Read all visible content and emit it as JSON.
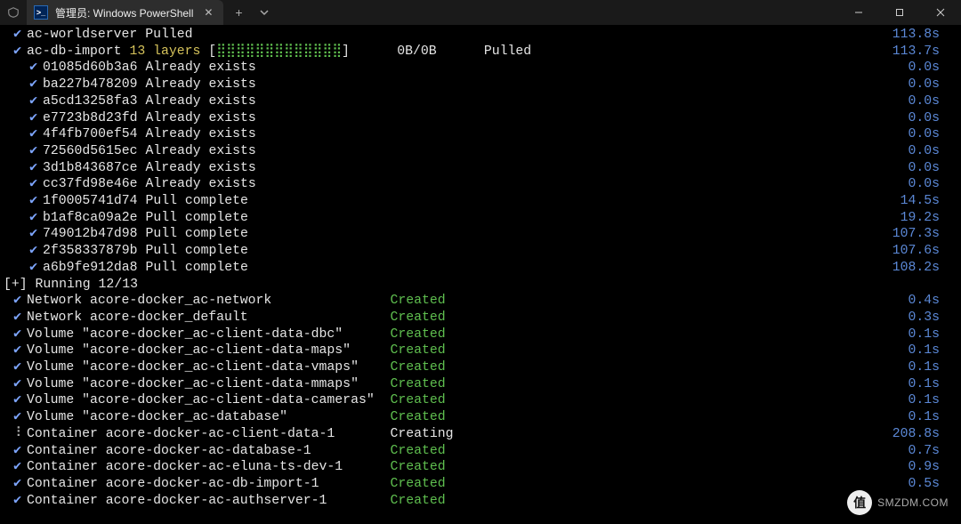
{
  "window": {
    "tab_title": "管理员: Windows PowerShell"
  },
  "pulls": [
    {
      "ind": "top",
      "name": "ac-worldserver",
      "status": "Pulled",
      "status_cls": "white",
      "time": "113.8s"
    },
    {
      "ind": "top",
      "name": "ac-db-import",
      "layers": "13 layers",
      "bar": "[⣿⣿⣿⣿⣿⣿⣿⣿⣿⣿⣿⣿⣿]",
      "bytes": "0B/0B",
      "status": "Pulled",
      "status_cls": "white",
      "time": "113.7s"
    },
    {
      "ind": "sub",
      "name": "01085d60b3a6",
      "status": "Already exists",
      "status_cls": "white",
      "time": "0.0s"
    },
    {
      "ind": "sub",
      "name": "ba227b478209",
      "status": "Already exists",
      "status_cls": "white",
      "time": "0.0s"
    },
    {
      "ind": "sub",
      "name": "a5cd13258fa3",
      "status": "Already exists",
      "status_cls": "white",
      "time": "0.0s"
    },
    {
      "ind": "sub",
      "name": "e7723b8d23fd",
      "status": "Already exists",
      "status_cls": "white",
      "time": "0.0s"
    },
    {
      "ind": "sub",
      "name": "4f4fb700ef54",
      "status": "Already exists",
      "status_cls": "white",
      "time": "0.0s"
    },
    {
      "ind": "sub",
      "name": "72560d5615ec",
      "status": "Already exists",
      "status_cls": "white",
      "time": "0.0s"
    },
    {
      "ind": "sub",
      "name": "3d1b843687ce",
      "status": "Already exists",
      "status_cls": "white",
      "time": "0.0s"
    },
    {
      "ind": "sub",
      "name": "cc37fd98e46e",
      "status": "Already exists",
      "status_cls": "white",
      "time": "0.0s"
    },
    {
      "ind": "sub",
      "name": "1f0005741d74",
      "status": "Pull complete",
      "status_cls": "white",
      "time": "14.5s"
    },
    {
      "ind": "sub",
      "name": "b1af8ca09a2e",
      "status": "Pull complete",
      "status_cls": "white",
      "time": "19.2s"
    },
    {
      "ind": "sub",
      "name": "749012b47d98",
      "status": "Pull complete",
      "status_cls": "white",
      "time": "107.3s"
    },
    {
      "ind": "sub",
      "name": "2f358337879b",
      "status": "Pull complete",
      "status_cls": "white",
      "time": "107.6s"
    },
    {
      "ind": "sub",
      "name": "a6b9fe912da8",
      "status": "Pull complete",
      "status_cls": "white",
      "time": "108.2s"
    }
  ],
  "running_header": "[+] Running 12/13",
  "resources": [
    {
      "spin": false,
      "label": "Network acore-docker_ac-network",
      "status": "Created",
      "status_cls": "green",
      "time": "0.4s"
    },
    {
      "spin": false,
      "label": "Network acore-docker_default",
      "status": "Created",
      "status_cls": "green",
      "time": "0.3s"
    },
    {
      "spin": false,
      "label": "Volume \"acore-docker_ac-client-data-dbc\"",
      "status": "Created",
      "status_cls": "green",
      "time": "0.1s"
    },
    {
      "spin": false,
      "label": "Volume \"acore-docker_ac-client-data-maps\"",
      "status": "Created",
      "status_cls": "green",
      "time": "0.1s"
    },
    {
      "spin": false,
      "label": "Volume \"acore-docker_ac-client-data-vmaps\"",
      "status": "Created",
      "status_cls": "green",
      "time": "0.1s"
    },
    {
      "spin": false,
      "label": "Volume \"acore-docker_ac-client-data-mmaps\"",
      "status": "Created",
      "status_cls": "green",
      "time": "0.1s"
    },
    {
      "spin": false,
      "label": "Volume \"acore-docker_ac-client-data-cameras\"",
      "status": "Created",
      "status_cls": "green",
      "time": "0.1s"
    },
    {
      "spin": false,
      "label": "Volume \"acore-docker_ac-database\"",
      "status": "Created",
      "status_cls": "green",
      "time": "0.1s"
    },
    {
      "spin": true,
      "label": "Container acore-docker-ac-client-data-1",
      "status": "Creating",
      "status_cls": "white",
      "time": "208.8s"
    },
    {
      "spin": false,
      "label": "Container acore-docker-ac-database-1",
      "status": "Created",
      "status_cls": "green",
      "time": "0.7s"
    },
    {
      "spin": false,
      "label": "Container acore-docker-ac-eluna-ts-dev-1",
      "status": "Created",
      "status_cls": "green",
      "time": "0.9s"
    },
    {
      "spin": false,
      "label": "Container acore-docker-ac-db-import-1",
      "status": "Created",
      "status_cls": "green",
      "time": "0.5s"
    },
    {
      "spin": false,
      "label": "Container acore-docker-ac-authserver-1",
      "status": "Created",
      "status_cls": "green",
      "time": ""
    }
  ],
  "watermark": {
    "badge": "值",
    "text": "SMZDM.COM"
  }
}
